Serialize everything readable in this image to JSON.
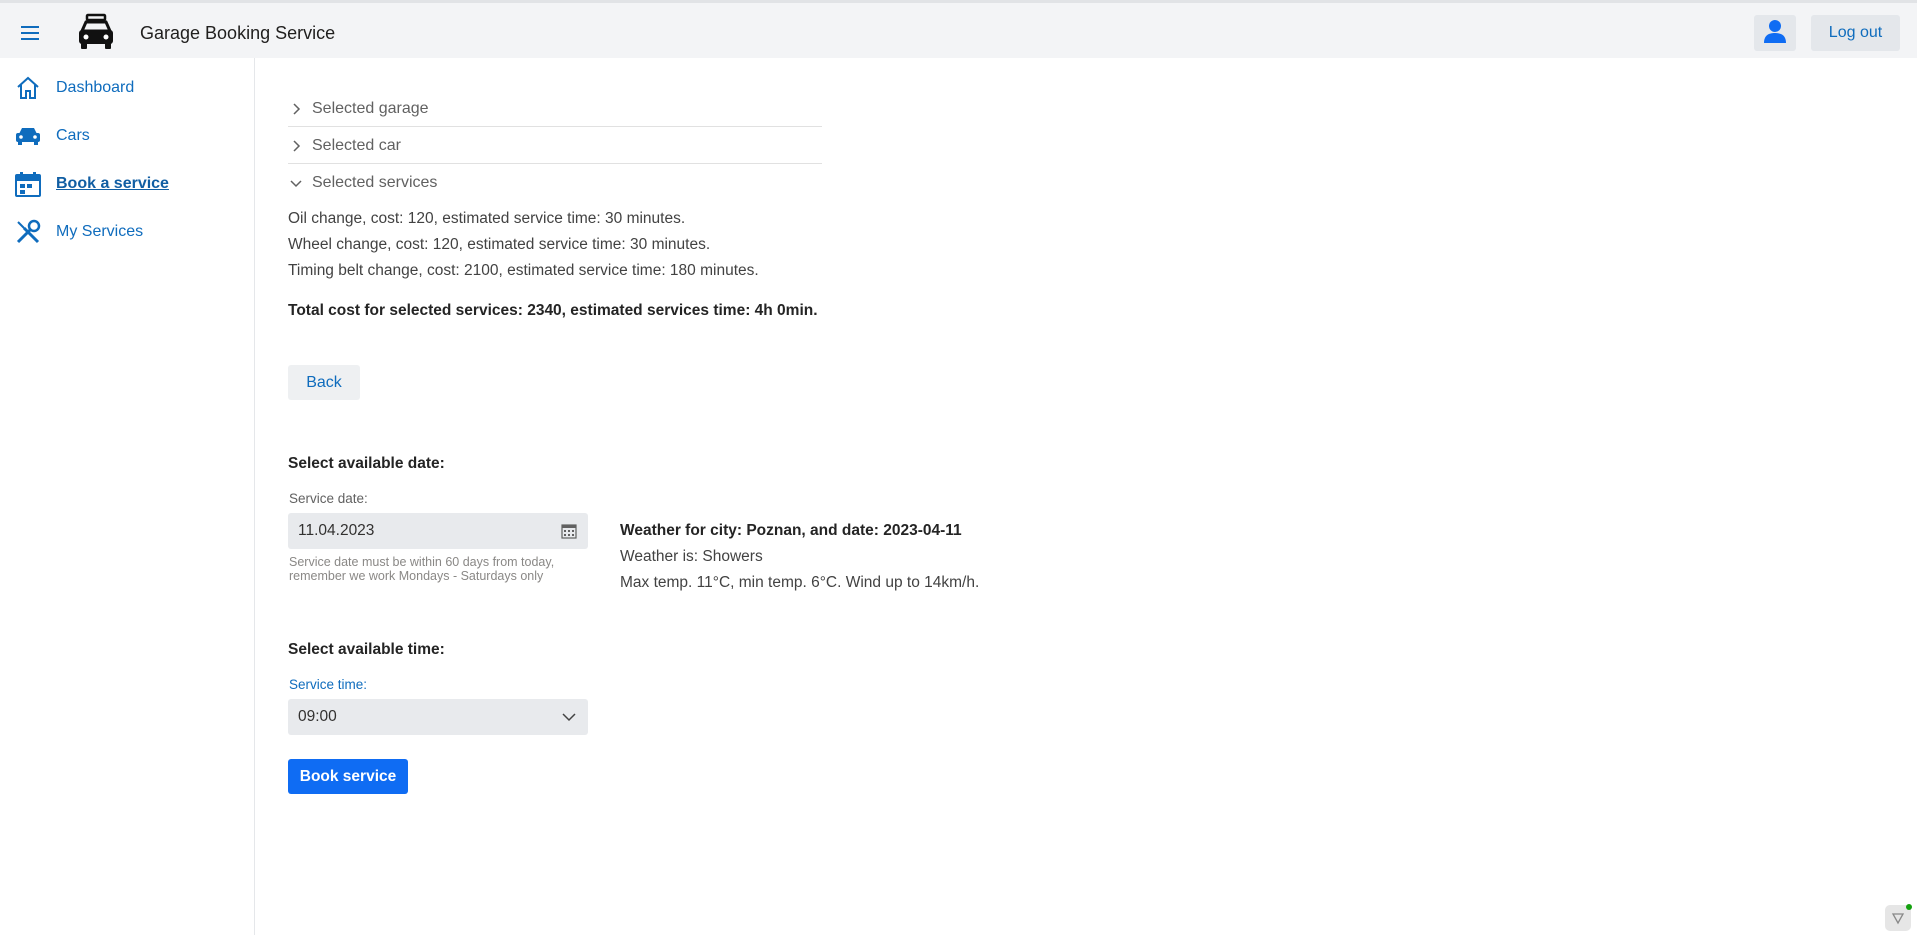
{
  "header": {
    "title": "Garage Booking Service",
    "logout_label": "Log out",
    "icons": {
      "menu": "hamburger-icon",
      "logo": "car-logo-icon",
      "user": "user-icon"
    }
  },
  "sidebar": {
    "items": [
      {
        "label": "Dashboard",
        "icon": "home-icon",
        "active": false
      },
      {
        "label": "Cars",
        "icon": "car-icon",
        "active": false
      },
      {
        "label": "Book a service",
        "icon": "calendar-icon",
        "active": true
      },
      {
        "label": "My Services",
        "icon": "tools-icon",
        "active": false
      }
    ]
  },
  "accordion": {
    "items": [
      {
        "label": "Selected garage",
        "expanded": false
      },
      {
        "label": "Selected car",
        "expanded": false
      },
      {
        "label": "Selected services",
        "expanded": true
      }
    ]
  },
  "services": {
    "lines": [
      "Oil change, cost: 120, estimated service time: 30 minutes.",
      "Wheel change, cost: 120, estimated service time: 30 minutes.",
      "Timing belt change, cost: 2100, estimated service time: 180 minutes."
    ],
    "total": "Total cost for selected services: 2340, estimated services time: 4h 0min."
  },
  "back_label": "Back",
  "date_section": {
    "heading": "Select available date:",
    "field_label": "Service date:",
    "value": "11.04.2023",
    "hint": "Service date must be within 60 days from today, remember we work Mondays - Saturdays only"
  },
  "weather": {
    "heading": "Weather for city: Poznan, and date: 2023-04-11",
    "condition": "Weather is: Showers",
    "details": "Max temp. 11°C, min temp. 6°C. Wind up to 14km/h."
  },
  "time_section": {
    "heading": "Select available time:",
    "field_label": "Service time:",
    "value": "09:00"
  },
  "book_label": "Book service",
  "colors": {
    "accent": "#0f6cbd",
    "primary_button": "#0f6cf3",
    "topbar": "#f3f4f6"
  }
}
